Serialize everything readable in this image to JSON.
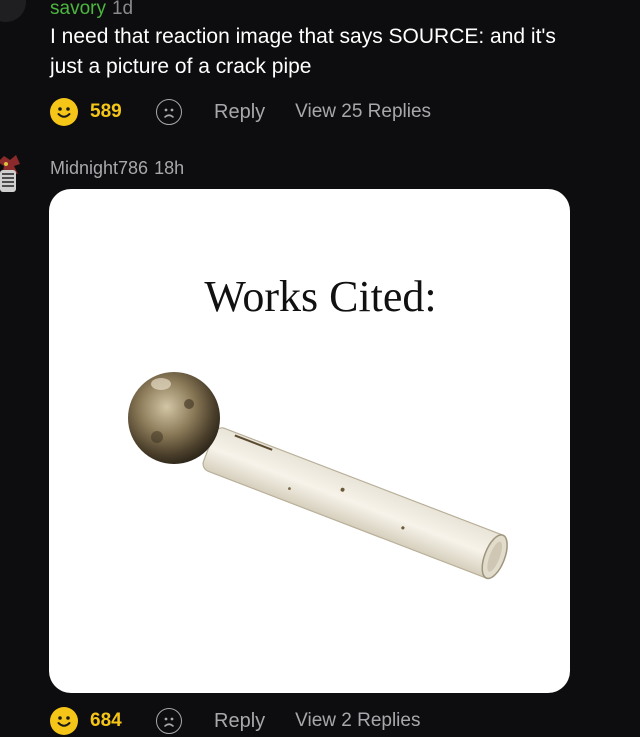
{
  "comment1": {
    "username": "savory",
    "time": "1d",
    "text_line1": "I need that reaction image that says SOURCE: and it's",
    "text_line2": "just a picture of a crack pipe",
    "likes": "589",
    "reply_label": "Reply",
    "view_replies_label": "View 25 Replies"
  },
  "comment2": {
    "username": "Midnight786",
    "time": "18h",
    "image_caption": "Works Cited:",
    "likes": "684",
    "reply_label": "Reply",
    "view_replies_label": "View 2 Replies"
  },
  "colors": {
    "background": "#0d0d0f",
    "username_green": "#4cb640",
    "like_yellow": "#f5c518",
    "muted_text": "#a8a8ac"
  },
  "icons": [
    "smile-icon",
    "sad-face-icon"
  ]
}
